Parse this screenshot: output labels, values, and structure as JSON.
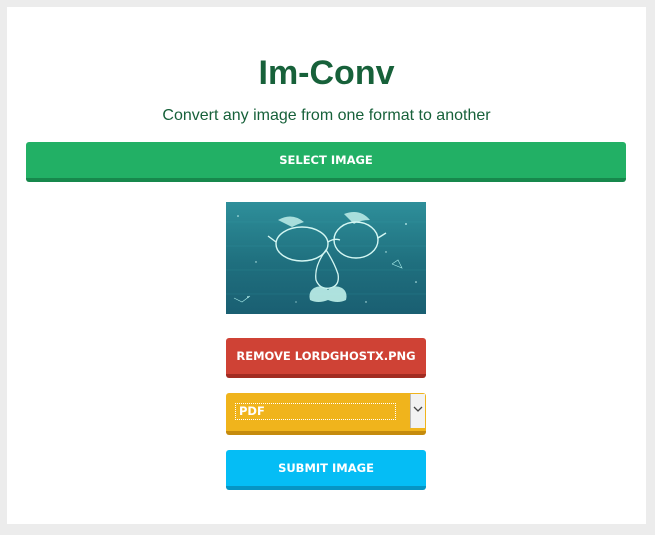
{
  "app": {
    "title": "Im-Conv",
    "subtitle": "Convert any image from one format to another"
  },
  "actions": {
    "select_label": "SELECT IMAGE",
    "remove_label": "REMOVE LORDGHOSTX.PNG",
    "submit_label": "SUBMIT IMAGE"
  },
  "format_select": {
    "selected": "PDF"
  },
  "preview": {
    "icon": "disguise-glasses-constellation-image"
  },
  "colors": {
    "title": "#17613a",
    "select_button": "#22b065",
    "remove_button": "#cf4235",
    "format_select": "#f0b41c",
    "submit_button": "#05bdf5"
  }
}
